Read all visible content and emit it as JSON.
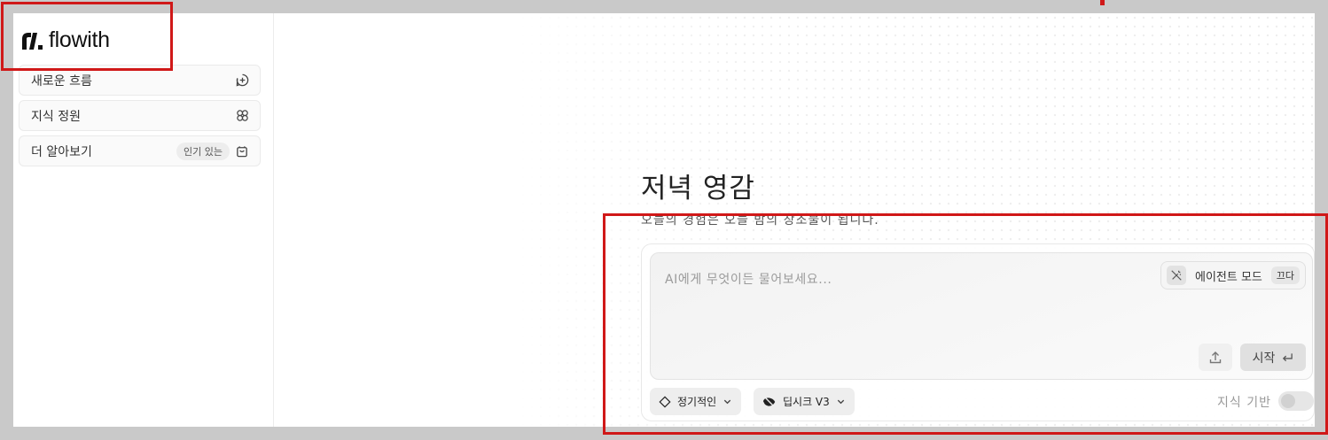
{
  "brand": {
    "name": "flowith"
  },
  "sidebar": {
    "items": [
      {
        "label": "새로운 흐름",
        "icon": "plus-circle-icon"
      },
      {
        "label": "지식 정원",
        "icon": "flower-icon"
      },
      {
        "label": "더 알아보기",
        "badge": "인기 있는",
        "icon": "shopping-bag-icon"
      }
    ]
  },
  "hero": {
    "title": "저녁 영감",
    "subtitle": "오늘의 경험은 오늘 밤의 창조물이 됩니다."
  },
  "composer": {
    "placeholder": "AI에게 무엇이든 물어보세요...",
    "agent_mode_label": "에이전트 모드",
    "agent_mode_state": "끄다",
    "start_label": "시작",
    "mode_chip": "정기적인",
    "model_chip": "딥시크 V3",
    "knowledge_label": "지식 기반"
  },
  "colors": {
    "annotation_red": "#d01818"
  }
}
